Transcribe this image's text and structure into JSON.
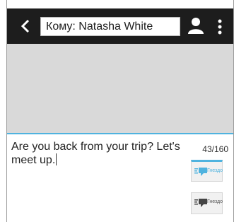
{
  "header": {
    "recipient_label": "Кому: Natasha White",
    "back_icon": "chevron-left-icon",
    "contacts_icon": "person-icon",
    "menu_icon": "more-vertical-icon"
  },
  "compose": {
    "message": "Are you back from your trip? Let's meet up.",
    "counter": "43/160"
  },
  "send_buttons": [
    {
      "label": "Гнездо",
      "state": "active"
    },
    {
      "label": "Гнездо",
      "state": "normal"
    }
  ],
  "colors": {
    "accent": "#4fb3df",
    "toolbar": "#1d1d1d",
    "thread_background": "#d9d9d9"
  }
}
